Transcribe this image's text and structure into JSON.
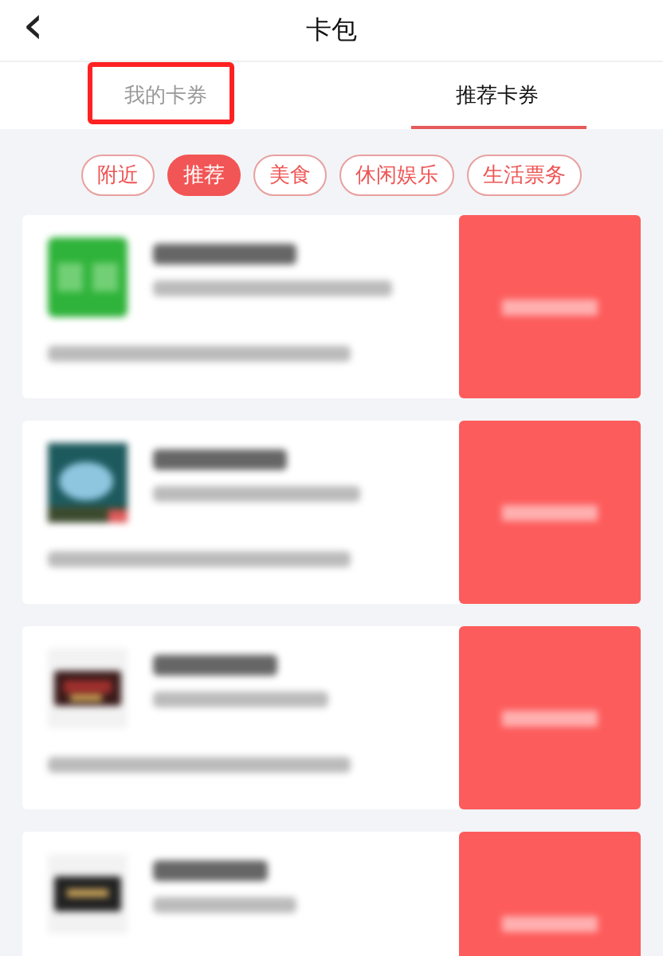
{
  "header": {
    "back_icon": "‹",
    "title": "卡包"
  },
  "tabs": [
    {
      "label": "我的卡券",
      "selected": false,
      "annotated": true
    },
    {
      "label": "推荐卡券",
      "selected": true,
      "annotated": false
    }
  ],
  "filters": [
    {
      "label": "附近",
      "selected": false
    },
    {
      "label": "推荐",
      "selected": true
    },
    {
      "label": "美食",
      "selected": false
    },
    {
      "label": "休闲娱乐",
      "selected": false
    },
    {
      "label": "生活票务",
      "selected": false
    }
  ],
  "cards": [
    {
      "kind": "coupon"
    },
    {
      "kind": "coupon"
    },
    {
      "kind": "coupon"
    },
    {
      "kind": "coupon"
    }
  ]
}
